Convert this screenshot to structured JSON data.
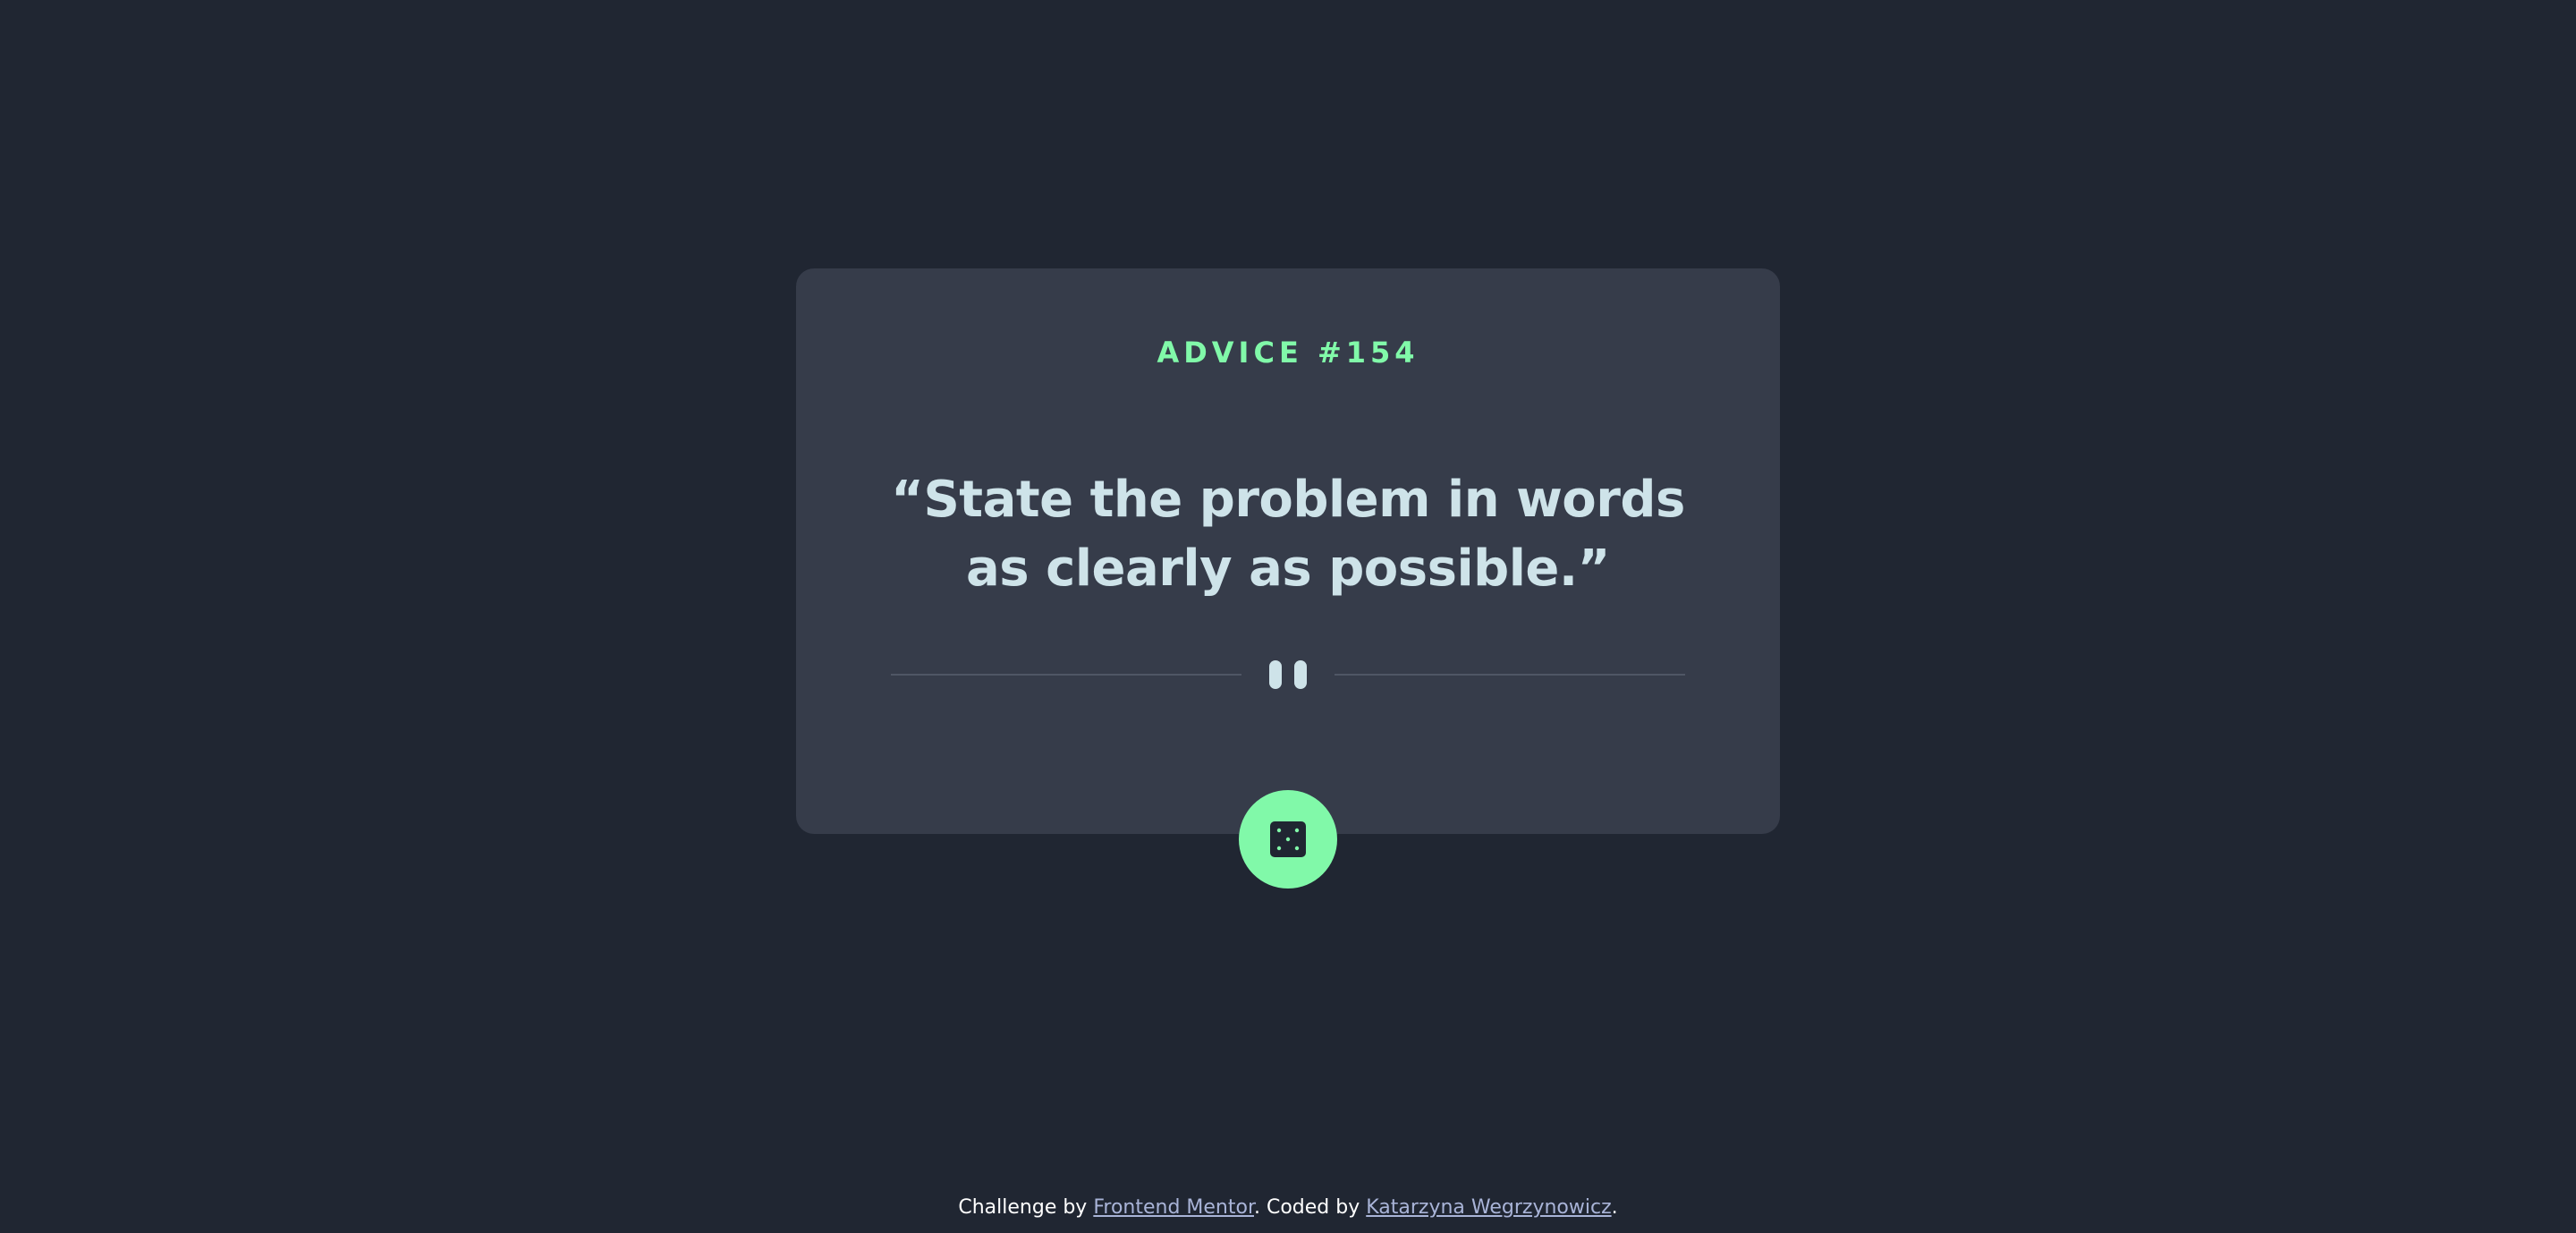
{
  "advice": {
    "label": "ADVICE #154",
    "quote": "“State the problem in words as clearly as possible.”"
  },
  "dice_button": {
    "icon": "dice-icon"
  },
  "footer": {
    "prefix": "Challenge by ",
    "link_frontend": "Frontend Mentor",
    "middle": ". Coded by ",
    "link_author": "Katarzyna Wegrzynowicz",
    "suffix": "."
  },
  "colors": {
    "background": "#202632",
    "card": "#363c4a",
    "accent": "#81f9a9",
    "text": "#cee3e9",
    "link": "#a9b4d8"
  }
}
